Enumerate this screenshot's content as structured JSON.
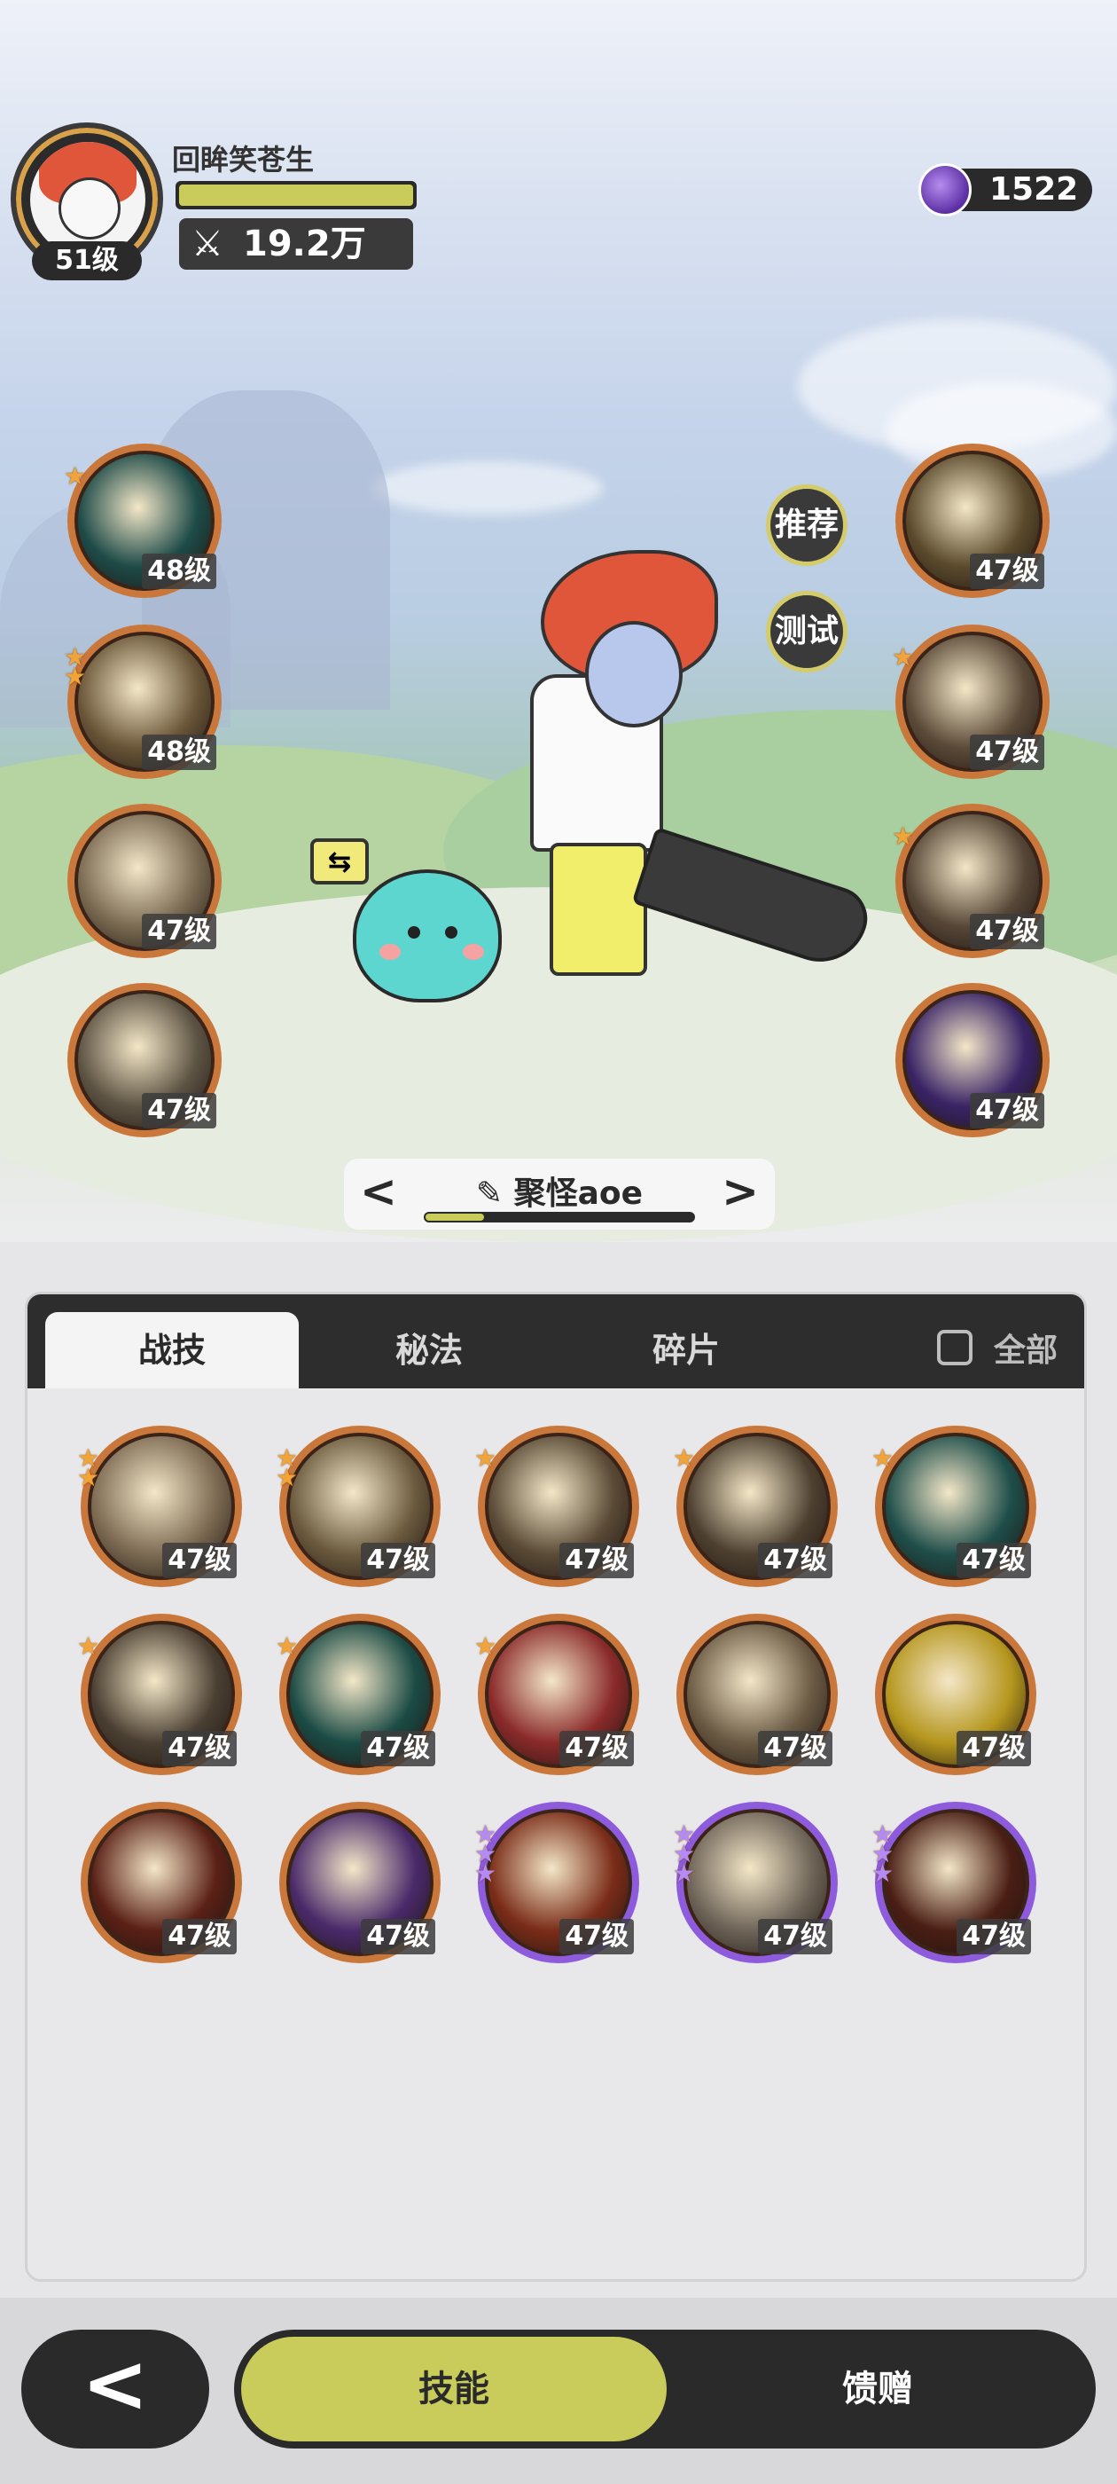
{
  "player": {
    "name": "回眸笑苍生",
    "level": "51级",
    "power": "19.2万",
    "exp_fraction": 1.0
  },
  "currency": {
    "amount": "1522",
    "icon": "purple-gem-icon"
  },
  "equipped_left": [
    {
      "level": "48级",
      "stars": 1,
      "icon": "web-slash-icon",
      "color": "#1e4b48"
    },
    {
      "level": "48级",
      "stars": 2,
      "icon": "burst-icon",
      "color": "#6a5638"
    },
    {
      "level": "47级",
      "stars": 0,
      "icon": "whirlwind-icon",
      "color": "#7a6a52"
    },
    {
      "level": "47级",
      "stars": 0,
      "icon": "spin-icon",
      "color": "#5e5444"
    }
  ],
  "equipped_right": [
    {
      "level": "47级",
      "stars": 0,
      "icon": "eye-icon",
      "color": "#5b4a2c"
    },
    {
      "level": "47级",
      "stars": 1,
      "icon": "sword-up-icon",
      "color": "#5b4a38"
    },
    {
      "level": "47级",
      "stars": 1,
      "icon": "sword-down-icon",
      "color": "#564636"
    },
    {
      "level": "47级",
      "stars": 0,
      "icon": "purple-orb-icon",
      "color": "#3a2466"
    }
  ],
  "buttons": {
    "recommend": "推荐",
    "test": "测试"
  },
  "preset": {
    "name": "聚怪aoe",
    "progress": 0.22,
    "prev": "<",
    "next": ">"
  },
  "tabs": [
    {
      "label": "战技",
      "active": true
    },
    {
      "label": "秘法",
      "active": false
    },
    {
      "label": "碎片",
      "active": false
    }
  ],
  "filter_all": "全部",
  "inventory": [
    {
      "level": "47级",
      "stars": 2,
      "rarity": "orange",
      "icon": "claw-slash-icon",
      "color": "#7c6a52"
    },
    {
      "level": "47级",
      "stars": 2,
      "rarity": "orange",
      "icon": "lightning-slash-icon",
      "color": "#6b5a3e"
    },
    {
      "level": "47级",
      "stars": 1,
      "rarity": "orange",
      "icon": "crescent-strike-icon",
      "color": "#5a4a36"
    },
    {
      "level": "47级",
      "stars": 1,
      "rarity": "orange",
      "icon": "triple-slash-icon",
      "color": "#4d4030"
    },
    {
      "level": "47级",
      "stars": 1,
      "rarity": "orange",
      "icon": "green-crescent-icon",
      "color": "#1f4e4a"
    },
    {
      "level": "47级",
      "stars": 1,
      "rarity": "orange",
      "icon": "warrior-slash-icon",
      "color": "#4a3f32"
    },
    {
      "level": "47级",
      "stars": 1,
      "rarity": "orange",
      "icon": "green-sword-icon",
      "color": "#1b4b45"
    },
    {
      "level": "47级",
      "stars": 1,
      "rarity": "orange",
      "icon": "red-warrior-icon",
      "color": "#8a2a2a"
    },
    {
      "level": "47级",
      "stars": 0,
      "rarity": "orange",
      "icon": "sword-light-icon",
      "color": "#6b5a44"
    },
    {
      "level": "47级",
      "stars": 0,
      "rarity": "orange",
      "icon": "golden-gem-icon",
      "color": "#b5961e"
    },
    {
      "level": "47级",
      "stars": 0,
      "rarity": "orange",
      "icon": "fire-arc-icon",
      "color": "#5a2016"
    },
    {
      "level": "47级",
      "stars": 0,
      "rarity": "orange",
      "icon": "purple-comet-icon",
      "color": "#4a2a6a"
    },
    {
      "level": "47级",
      "stars": 3,
      "rarity": "purple",
      "icon": "fire-rune-icon",
      "color": "#7a2c18"
    },
    {
      "level": "47级",
      "stars": 3,
      "rarity": "purple",
      "icon": "ghost-fist-icon",
      "color": "#6e6458"
    },
    {
      "level": "47级",
      "stars": 3,
      "rarity": "purple",
      "icon": "flame-ring-icon",
      "color": "#4a1e14"
    }
  ],
  "nav": {
    "back": "<",
    "skills": "技能",
    "gift": "馈赠"
  }
}
